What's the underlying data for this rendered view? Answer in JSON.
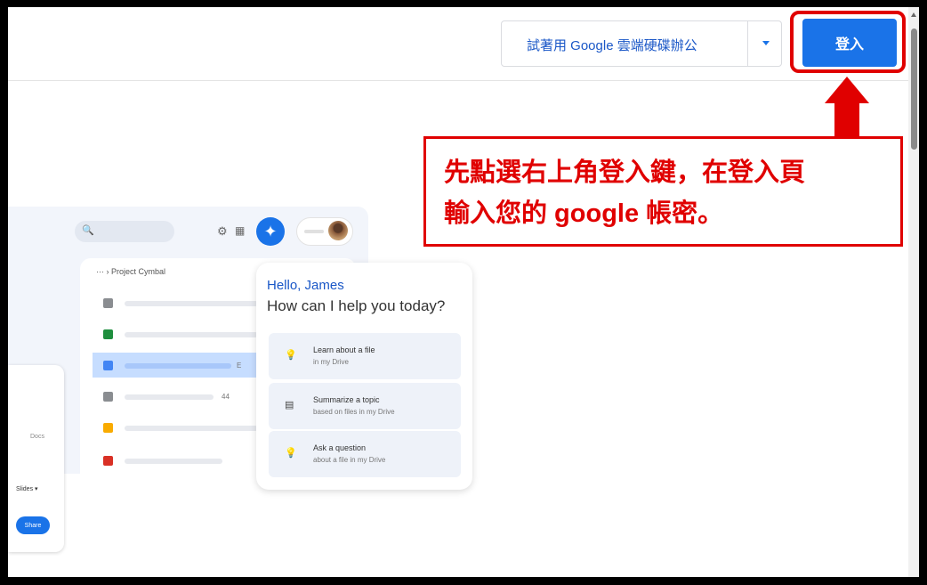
{
  "topbar": {
    "trial_label": "試著用 Google 雲端硬碟辦公",
    "signin_label": "登入"
  },
  "annotation": {
    "line1": "先點選右上角登入鍵，在登入頁",
    "line2": "輸入您的 google 帳密。",
    "color": "#e00000"
  },
  "illustration": {
    "breadcrumb": "··· › Project Cymbal",
    "file_extras": [
      "E",
      "44"
    ],
    "file_icon_colors": [
      "#8a8d91",
      "#1e8e3e",
      "#4285f4",
      "#8a8d91",
      "#f9ab00",
      "#d93025"
    ],
    "left_card": {
      "text1": "Docs",
      "text2": "Slides ▾",
      "button": "Share"
    },
    "gemini": {
      "greeting": "Hello, James",
      "question": "How can I help you today?",
      "suggestions": [
        {
          "icon": "lightbulb-icon",
          "title": "Learn about a file",
          "subtitle": "in my Drive"
        },
        {
          "icon": "summarize-icon",
          "title": "Summarize a topic",
          "subtitle": "based on files in my Drive"
        },
        {
          "icon": "lightbulb-icon",
          "title": "Ask a question",
          "subtitle": "about a file in my Drive"
        }
      ]
    }
  },
  "colors": {
    "accent": "#1a73e8",
    "annotation_red": "#e00000"
  }
}
